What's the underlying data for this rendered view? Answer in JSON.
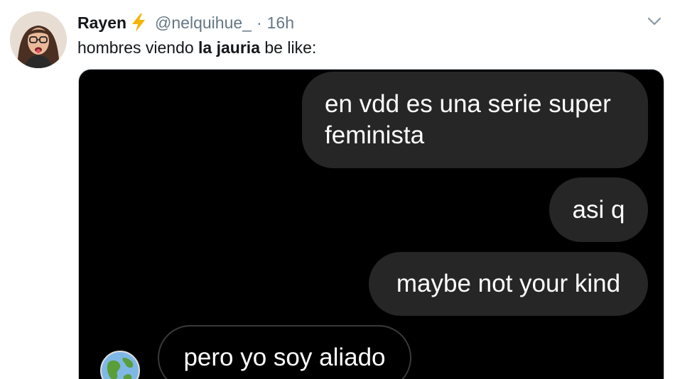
{
  "tweet": {
    "display_name": "Rayen",
    "name_emoji": "lightning-bolt-icon",
    "handle": "@nelquihue_",
    "separator": "·",
    "time": "16h",
    "text_before": "hombres viendo ",
    "text_bold": "la jauria",
    "text_after": " be like:"
  },
  "media": {
    "messages": [
      {
        "text": "en vdd es una serie super feminista",
        "sender": "self"
      },
      {
        "text": "asi q",
        "sender": "self"
      },
      {
        "text": "maybe not your kind",
        "sender": "self"
      },
      {
        "text": "pero yo soy aliado",
        "sender": "other"
      }
    ],
    "other_avatar": "globe-icon"
  },
  "colors": {
    "accent_bolt": "#f4b400",
    "muted_text": "#657786",
    "bubble_bg": "#262626",
    "media_bg": "#000000"
  }
}
